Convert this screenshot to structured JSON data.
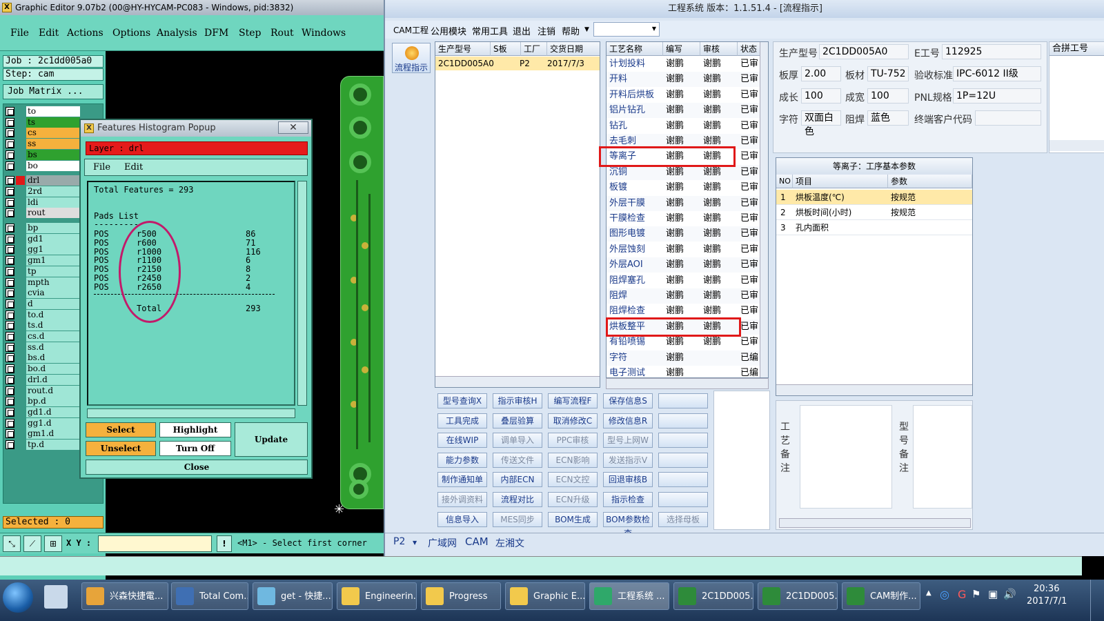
{
  "ge": {
    "title": "Graphic Editor 9.07b2 (00@HY-HYCAM-PC083 - Windows, pid:3832)",
    "menu": [
      "File",
      "Edit",
      "Actions",
      "Options",
      "Analysis",
      "DFM",
      "Step",
      "Rout",
      "Windows"
    ],
    "job": "Job : 2c1dd005a0",
    "step": "Step: cam",
    "job_matrix": "Job Matrix ...",
    "layers": [
      "to",
      "ts",
      "cs",
      "ss",
      "bs",
      "bo",
      "drl",
      "2rd",
      "ldi",
      "rout",
      "bp",
      "gd1",
      "gg1",
      "gm1",
      "tp",
      "mpth",
      "cvia",
      "d",
      "to.d",
      "ts.d",
      "cs.d",
      "ss.d",
      "bs.d",
      "bo.d",
      "drl.d",
      "rout.d",
      "bp.d",
      "gd1.d",
      "gg1.d",
      "gm1.d",
      "tp.d"
    ],
    "selected": "Selected : 0",
    "xy_label": "X Y :",
    "prompt": "<M1> - Select first corner"
  },
  "popup": {
    "title": "Features Histogram Popup",
    "layer": "Layer :  drl",
    "menu": [
      "File",
      "Edit"
    ],
    "total": "Total Features = 293",
    "pads_title": "Pads List",
    "pads_rule": "---------",
    "pads": [
      {
        "pol": "POS",
        "sym": "r500",
        "count": "86"
      },
      {
        "pol": "POS",
        "sym": "r600",
        "count": "71"
      },
      {
        "pol": "POS",
        "sym": "r1000",
        "count": "116"
      },
      {
        "pol": "POS",
        "sym": "r1100",
        "count": "6"
      },
      {
        "pol": "POS",
        "sym": "r2150",
        "count": "8"
      },
      {
        "pol": "POS",
        "sym": "r2450",
        "count": "2"
      },
      {
        "pol": "POS",
        "sym": "r2650",
        "count": "4"
      }
    ],
    "total_label": "Total",
    "total_value": "293",
    "buttons": {
      "select": "Select",
      "highlight": "Highlight",
      "update": "Update",
      "unselect": "Unselect",
      "turn_off": "Turn Off",
      "close": "Close"
    }
  },
  "ew": {
    "title": "工程系统   版本：1.1.51.4 - [流程指示]",
    "menu": [
      "CAM工程",
      "公用模块",
      "常用工具",
      "退出",
      "注销",
      "帮助"
    ],
    "side_button": "流程指示",
    "prod_grid": {
      "headers": [
        "生产型号",
        "S板",
        "工厂",
        "交货日期"
      ],
      "row": [
        "2C1DD005A0",
        "",
        "P2",
        "2017/7/3"
      ]
    },
    "proc_grid": {
      "headers": [
        "工艺名称",
        "编写",
        "审核",
        "状态"
      ],
      "rows": [
        [
          "计划投料",
          "谢鹏",
          "谢鹏",
          "已审"
        ],
        [
          "开料",
          "谢鹏",
          "谢鹏",
          "已审"
        ],
        [
          "开料后烘板",
          "谢鹏",
          "谢鹏",
          "已审"
        ],
        [
          "铝片钻孔",
          "谢鹏",
          "谢鹏",
          "已审"
        ],
        [
          "钻孔",
          "谢鹏",
          "谢鹏",
          "已审"
        ],
        [
          "去毛刺",
          "谢鹏",
          "谢鹏",
          "已审"
        ],
        [
          "等离子",
          "谢鹏",
          "谢鹏",
          "已审"
        ],
        [
          "沉铜",
          "谢鹏",
          "谢鹏",
          "已审"
        ],
        [
          "板镀",
          "谢鹏",
          "谢鹏",
          "已审"
        ],
        [
          "外层干膜",
          "谢鹏",
          "谢鹏",
          "已审"
        ],
        [
          "干膜检查",
          "谢鹏",
          "谢鹏",
          "已审"
        ],
        [
          "图形电镀",
          "谢鹏",
          "谢鹏",
          "已审"
        ],
        [
          "外层蚀刻",
          "谢鹏",
          "谢鹏",
          "已审"
        ],
        [
          "外层AOI",
          "谢鹏",
          "谢鹏",
          "已审"
        ],
        [
          "阻焊塞孔",
          "谢鹏",
          "谢鹏",
          "已审"
        ],
        [
          "阻焊",
          "谢鹏",
          "谢鹏",
          "已审"
        ],
        [
          "阻焊检查",
          "谢鹏",
          "谢鹏",
          "已审"
        ],
        [
          "烘板整平",
          "谢鹏",
          "谢鹏",
          "已审"
        ],
        [
          "有铅喷锡",
          "谢鹏",
          "谢鹏",
          "已审"
        ],
        [
          "字符",
          "谢鹏",
          "",
          "已编"
        ],
        [
          "电子测试",
          "谢鹏",
          "",
          "已编"
        ]
      ]
    },
    "info": {
      "labels": [
        "生产型号",
        "E工号",
        "板厚",
        "板材",
        "验收标准",
        "成长",
        "成宽",
        "PNL规格",
        "字符",
        "阻焊",
        "终端客户代码"
      ],
      "values": {
        "model": "2C1DD005A0",
        "eno": "112925",
        "thick": "2.00",
        "material": "TU-752",
        "standard": "IPC-6012 II级",
        "len": "100",
        "wid": "100",
        "pnl": "1P=12U",
        "char": "双面白色",
        "mask": "蓝色",
        "client": ""
      }
    },
    "right_tab": "合拼工号",
    "param": {
      "title": "等离子：工序基本参数",
      "headers": [
        "NO",
        "项目",
        "参数"
      ],
      "rows": [
        [
          "1",
          "烘板温度(℃)",
          "按规范"
        ],
        [
          "2",
          "烘板时间(小时)",
          "按规范"
        ],
        [
          "3",
          "孔内面积",
          ""
        ]
      ]
    },
    "buttons": [
      [
        "型号查询X",
        "指示审核H",
        "编写流程F",
        "保存信息S",
        ""
      ],
      [
        "工具完成",
        "叠层验算",
        "取消修改C",
        "修改信息R",
        ""
      ],
      [
        "在线WIP",
        "调单导入",
        "PPC审核",
        "型号上网W",
        ""
      ],
      [
        "能力参数",
        "传送文件",
        "ECN影响",
        "发送指示V",
        ""
      ],
      [
        "制作通知单",
        "内部ECN",
        "ECN文控",
        "回退审核B",
        ""
      ],
      [
        "接外调资料",
        "流程对比",
        "ECN升级",
        "指示检查",
        ""
      ],
      [
        "信息导入",
        "MES同步",
        "BOM生成",
        "BOM参数检查",
        "选择母板"
      ]
    ],
    "disabled": [
      "调单导入",
      "PPC审核",
      "型号上网W",
      "传送文件",
      "ECN影响",
      "发送指示V",
      "ECN文控",
      "ECN升级",
      "MES同步",
      "接外调资料",
      "选择母板"
    ],
    "notes": {
      "left": "工艺备注",
      "right": "型号备注"
    },
    "status": [
      "P2",
      "广域网",
      "CAM",
      "左湘文"
    ]
  },
  "taskbar": {
    "items": [
      "兴森快捷電...",
      "Total Com...",
      "get - 快捷...",
      "Engineerin...",
      "Progress",
      "Graphic E...",
      "工程系统 ...",
      "2C1DD005...",
      "2C1DD005...",
      "CAM制作..."
    ],
    "time": "20:36",
    "date": "2017/7/1"
  }
}
